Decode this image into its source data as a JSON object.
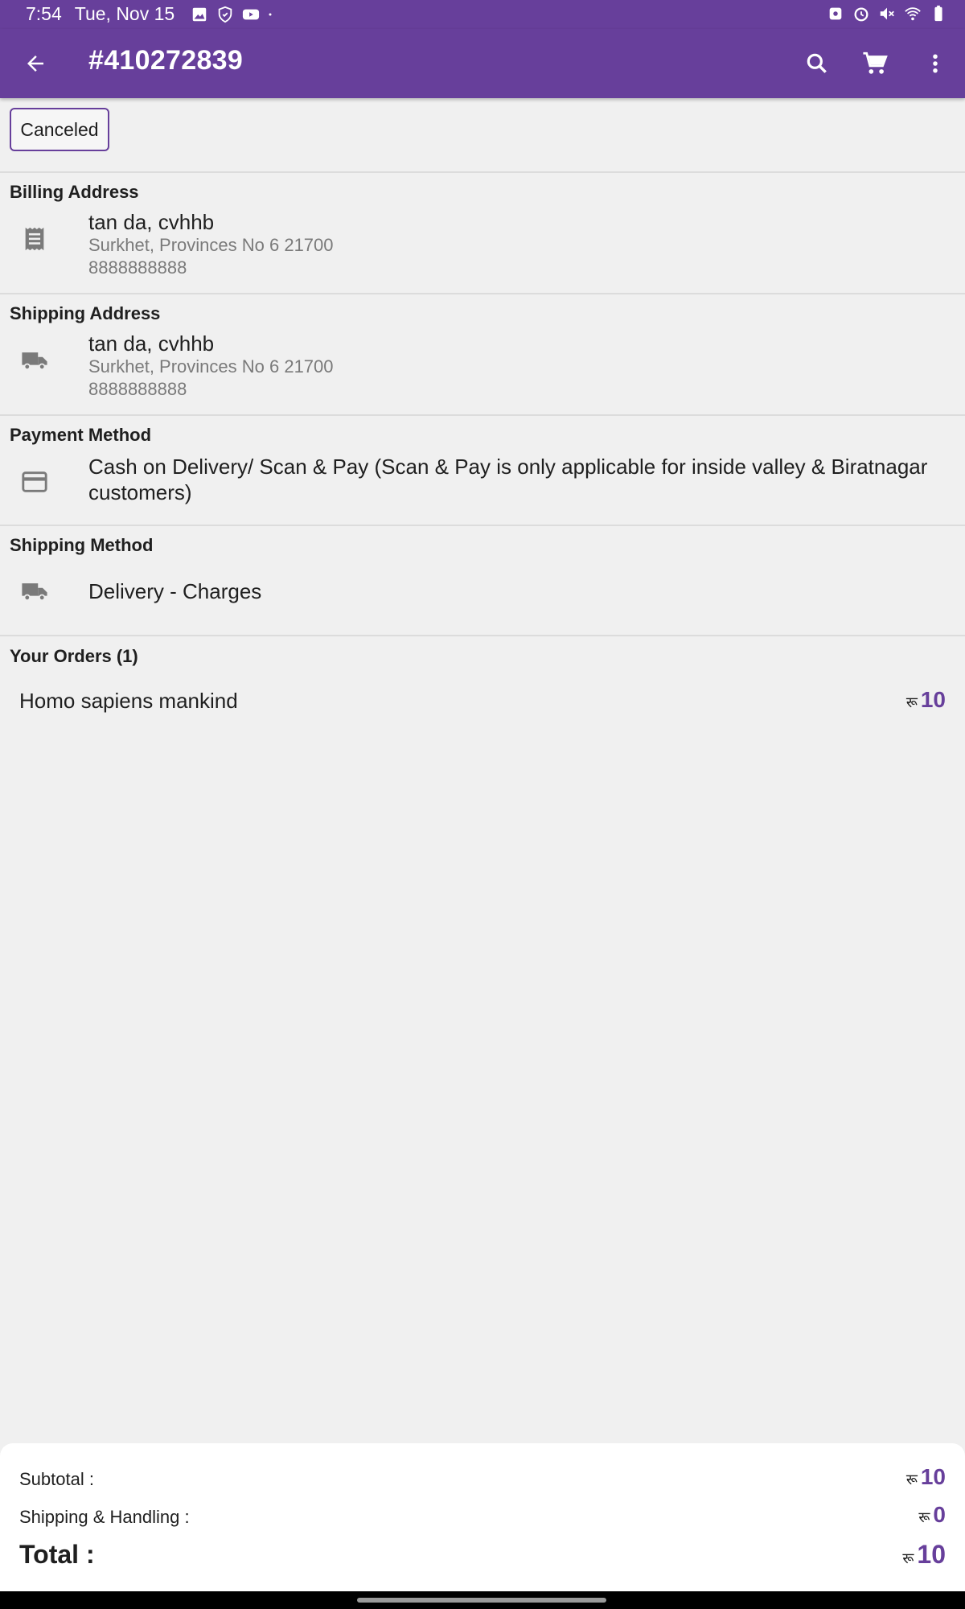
{
  "status_bar": {
    "time": "7:54",
    "date": "Tue, Nov 15",
    "left_icons": [
      "gallery-icon",
      "hand-shield-icon",
      "youtube-icon",
      "dot-icon"
    ],
    "right_icons": [
      "lock-icon",
      "alarm-icon",
      "mute-icon",
      "wifi-icon",
      "battery-icon"
    ]
  },
  "app_bar": {
    "title": "#410272839",
    "actions": [
      "search-icon",
      "cart-icon",
      "more-vert-icon"
    ]
  },
  "order_status": "Canceled",
  "billing": {
    "title": "Billing Address",
    "name": "tan da, cvhhb",
    "address": "Surkhet, Provinces No 6 21700",
    "phone": "8888888888"
  },
  "shipping": {
    "title": "Shipping Address",
    "name": "tan da, cvhhb",
    "address": "Surkhet, Provinces No 6 21700",
    "phone": "8888888888"
  },
  "payment": {
    "title": "Payment Method",
    "text": "Cash on Delivery/ Scan & Pay (Scan & Pay is only applicable for inside valley & Biratnagar customers)"
  },
  "shipping_method": {
    "title": "Shipping Method",
    "text": "Delivery - Charges"
  },
  "orders": {
    "title": "Your Orders (1)",
    "items": [
      {
        "name": "Homo sapiens mankind",
        "currency": "रू",
        "price": "10"
      }
    ]
  },
  "summary": {
    "subtotal_label": "Subtotal :",
    "subtotal_currency": "रू",
    "subtotal_value": "10",
    "shipping_label": "Shipping & Handling :",
    "shipping_currency": "रू",
    "shipping_value": "0",
    "total_label": "Total :",
    "total_currency": "रू",
    "total_value": "10"
  },
  "colors": {
    "primary": "#673f9b",
    "background": "#f0f0f0",
    "summary_background": "#ffffff"
  }
}
